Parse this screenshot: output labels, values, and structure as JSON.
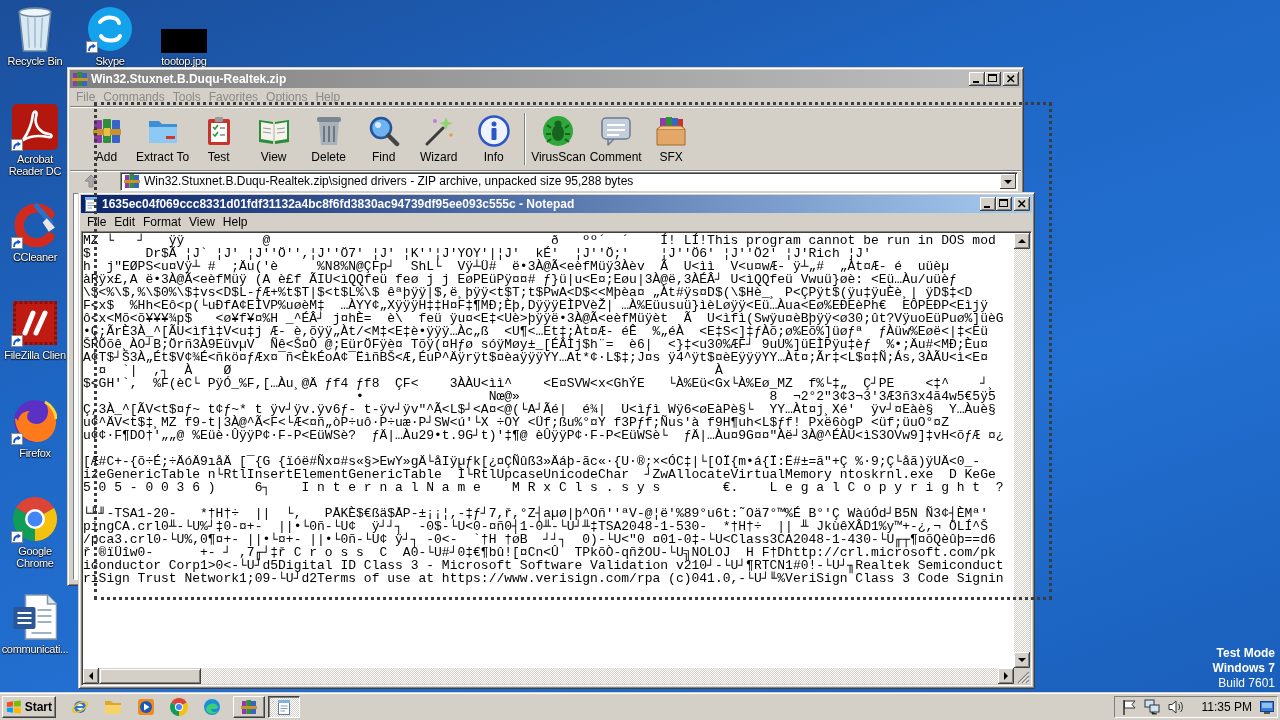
{
  "desktop": {
    "icon_columns": [
      [
        {
          "label": "Recycle Bin",
          "kind": "recycle-bin",
          "shortcut": false
        },
        {
          "label": "Acrobat Reader DC",
          "kind": "acrobat",
          "shortcut": true
        },
        {
          "label": "CCleaner",
          "kind": "ccleaner",
          "shortcut": true
        },
        {
          "label": "FileZilla Clien",
          "kind": "filezilla",
          "shortcut": true
        },
        {
          "label": "Firefox",
          "kind": "firefox",
          "shortcut": true
        },
        {
          "label": "Google Chrome",
          "kind": "chrome",
          "shortcut": true
        },
        {
          "label": "communicati...",
          "kind": "word-doc",
          "shortcut": false
        }
      ],
      [
        {
          "label": "Skype",
          "kind": "skype",
          "shortcut": true
        }
      ],
      [
        {
          "label": "tootop.jpg",
          "kind": "image-file",
          "shortcut": false
        }
      ]
    ],
    "os_notice": [
      "Test Mode",
      "Windows 7",
      "Build 7601"
    ]
  },
  "winrar": {
    "title": "Win32.Stuxnet.B.Duqu-Realtek.zip",
    "active": false,
    "menu": [
      "File",
      "Commands",
      "Tools",
      "Favorites",
      "Options",
      "Help"
    ],
    "toolbar": [
      [
        {
          "label": "Add",
          "kind": "add"
        },
        {
          "label": "Extract To",
          "kind": "extract"
        },
        {
          "label": "Test",
          "kind": "test"
        },
        {
          "label": "View",
          "kind": "view"
        },
        {
          "label": "Delete",
          "kind": "delete"
        },
        {
          "label": "Find",
          "kind": "find"
        },
        {
          "label": "Wizard",
          "kind": "wizard"
        },
        {
          "label": "Info",
          "kind": "info"
        }
      ],
      [
        {
          "label": "VirusScan",
          "kind": "virusscan"
        },
        {
          "label": "Comment",
          "kind": "comment"
        },
        {
          "label": "SFX",
          "kind": "sfx"
        }
      ]
    ],
    "path": "Win32.Stuxnet.B.Duqu-Realtek.zip\\signed drivers - ZIP archive, unpacked size 95,288 bytes"
  },
  "notepad": {
    "title": "1635ec04f069ccc8331d01fdf31132a4bc8f6fd3830ac94739df95ee093c555c - Notepad",
    "active": true,
    "menu": [
      "File",
      "Edit",
      "Format",
      "View",
      "Help"
    ],
    "text_blocks": [
      [
        "MZ └   ┘   ÿÿ          @                                    ð   ºº´  ´    Í! LÍ!This program cannot be run in DOS mod",
        "$       Dr$Ã ¦J` ¦J' ¦J''Ö'',¦J''Ö7' ¦J' ¦K''¦J'YOY'|¦J'  kÉ'  ¦J''Ö;'    ¦J''Ö6' ¦J''Ö2' ¦J'Rich ¦J'",
        "h  j\"EØPS<u¤Vÿ┴ #  ;Äu('è     %N8%N@ÇFp┘  ShL└  Vÿ┴Ü#  ë•3À@Ã<eèfMüÿ3Àèv  Ã  U<ìì  V<u¤wÆ- ÿ┴„#  „Àt¤Æ- é  uüèµ",
        "àRÿx£,A ë•3À@Ã<eèfMüÿ (A è£f ÃIU<ìQQfeü feø j j EøPEüPÿ¤¤# ƒ}ü|u<E¤;Eøu|3À@ë,3ÀÉÂ┘ U<ìQQfeü Vwuü}øè: <Eü…Àu/uüèƒ",
        "\\$<%\\$,%\\$0%\\$‡vs<D$L-ƒÆ+%t$T|$<t$L%\\$ êªþÿÿ|$,ë¸þÿÿ<t$T;t$PwA<D$<<Mþèa¤ „Àt#ÿs¤D$(\\$Hè_¸ P<ÇPÿt$(ÿu‡ÿuÈè¸| ÿD$‡<D",
        "F<x$  %Hh<Eô<p(└uÐfA¢EÌVP%uøèM‡  …ÀYY¢„XÿÿÿH‡‡H¤F‡¶MÐ;Èþ,DÿÿÿEÌPVèŽ| …À%Eüusuü}ìèLøÿÿ<Eü…Àua<Eø%EÐEèPh€  EÔPEÐP<Eìjÿ",
        "ô<x<Mõ<õ¥¥¥¾p$   <ø¥f¥¤%H _^ÉÂ┘ j¤hÈ=  è\\  feü ÿu¤<E‡<Uè>þÿÿë•3À@Ã<eèfMüÿèt  Ã  U<ìfì(Swÿu¤èBþÿÿ<ø30;ût?VÿuoEüPuø%]üèG",
        "•Ç;ÃrÈ3À_^[ÃU<ìfì‡V<u‡j Æ- è,õÿÿ„Àt/<M‡<E‡è•ÿÿÿ…Àc„ß  <U¶<…Et‡;Àt¤Æ- éÊ  %„éÀ  <E‡S<]‡ƒÀõ;ø%Eõ%]üøƒª  ƒÀüw%Eøë<|‡<Eü",
        "ŠRÕõê¸ÀO┘B;Örñ3À9EüvµV  Ñê<Š¤Ò @;EürÖFÿè¤ Tõÿ(¤Hƒø sóÿMøy±_[ÉÂÌj$h¨=  è6|  <}‡<u30%ÆF┘ 9uU%]üEÌPÿu‡èƒ  %•;Äu#<MÐ;Èu¤",
        "A¢T$┘Š3À„Ét$V¢¾É<ñkö¤ƒÆx¤¯ñ<ÈkÉoA¢¯ËìñBŠ<Æ,ÉuP^Äÿrÿt$¤èaÿÿÿYY…At*¢·L$‡;J¤s ÿ4^ÿt$¤èEÿÿÿYY…Àt¤;Ãr‡<L$¤‡Ñ;Ás,3ÀÃU<ì<E¤",
        "  ¤  `|  ,┐  À    Ø                                                              À",
        "$<GH'`,  %F(èC└ PÿÓ_%F,[…Àu¸@Ä ƒf4 ƒf8  ÇF<    3ÀÀU<ìì^    <E¤SVW<x<GhÝE   └À%Eü<Gx└À%Eø_MZ  f%└‡„  Ç┘PE    <‡^    ┘¸",
        "                                   •                Nœ@»                                8  ¬2°2\"3¢3¬3'3Æ3ñ3x4ã4w5€5ÿ5",
        "Ç,3À_^[ÃV<t$¤ƒ~ t¢ƒ~* t ÿv┘ÿv.ÿv6ƒ- t-ÿv┘ÿv\"^Ã<L$┘<A¤<@(└A┘Ãé|  é¾|  U<ìƒì Wÿ6<øEàPè§└  YY…Àt¤j¸Xé'  ÿv┘¤Eàè§  Y…Àuè§",
        "u¢^ÄV<t$‡¸MZ f9-t|3À@^Ã<F<└Æ<¤ñ„òP÷uô·P÷uæ·P┘SW<ú'└X ÷OY <Üf;ßu%°¤Y f3Pƒf;Ñus'à f9H¶uh<L$ƒf! Pxë6ògP <üf;üuO°¤Z",
        "u¢¢·F¶DO†'„„@ %Eüè·ÛÿÿP¢·F-P<EüWSè?  ƒÄ|…Àu29•t.9G┘t)'‡¶@ èÛÿÿP¢·F-P<EüWSè└  ƒÄ|…Àu¤9G¤¤\"Àë┘3À@^ÉÀU<ìS3OVw9]‡vH<õƒÆ ¤¿"
      ],
      [
        "[Æ#C+-{õ÷É;÷ÄóÄ9ıåÄ [¯{G {ïóë#Ñx¤#s«§>EwY»gÄ└åIÿµƒk[¿¤ÇÑûß3»Äáþ-ãc«·{U·®;×<ÓC‡|└[OÏ{m•á{Ï:Ë#±=ã\"+Ç %·9;Ç└åã)ÿUÄ<0_-",
        "izeGenericTable n└RtlInsertElementGenericTable  Ì└RtlUpcaseUnicodeChar  ┘ZwAllocateVirtualMemory ntoskrnl.exe  D KeGe",
        "5 0 5 - 0 0 3 6 )     6┐    I n t e r n a l N a m e    M R x C l s . s y s        €.    L e g a l C o p y r i g h t  ?"
      ],
      [
        "└╜╜-TSA1-20-   *†H†÷  ||  └,   PÅKÈ$€ßä$ÅP-±¡¡¦,-‡ƒ┘7,ř,°Z┤aµø|þ^Oñ''ªV-@¦ë'%89°u6t:˜Oä7°™%É B°'Ç WàúÓd┘B5N Ñ3¢┤ÈMª'",
        "pingCA.crl0╨-└U%┘‡0-¤+-  ||•└0ñ-└U¢  ÿ┘┘┐  -0$-└U<0-¤ñ0┤1-0╨-└U┘╨‡TSA2048-1-530-  *†H†÷  || ╨ JkùêXÂD1%y™+-¿,¬ ÖLÍ^Š",
        "/pca3.crl0-└U%,0¶¤+- ||•└¤+- ||•└0ñ-└U¢ ÿ┘┐ -0<-  `†H †øB  ┘┘┐  0)-└U<\"0 ¤01-0‡-└U<Class3CA2048-1-430-└U╓┬¶¤õQèûþ==d6",
        "ř.®ïÜîw0-      +- ┘ ,7╓┘‡ř C r o s s  C  A0-└U#┘0‡€¶bû![¤Cn<Û  TPkõÒ-qñžOU-└U╗NOLOJ  H F†Dhttp://crl.microsoft.com/pk",
        "iconductor Corp1>0<-└U┘d5Digital ID Class 3 - Microsoft Software Validation v210┘-└U┘¶RTCN1#0!-└U┘╖Realtek Semiconduct",
        "riSign Trust Network1;09-└U┘d2Terms of use at https://www.verisign.com/rpa (c)041.0,-└U┘╙%VeriSign Class 3 Code Signin"
      ]
    ]
  },
  "taskbar": {
    "start": "Start",
    "tasks": [
      {
        "kind": "winrar",
        "selected": false
      },
      {
        "kind": "notepad",
        "selected": true
      }
    ],
    "clock": "11:35 PM"
  }
}
